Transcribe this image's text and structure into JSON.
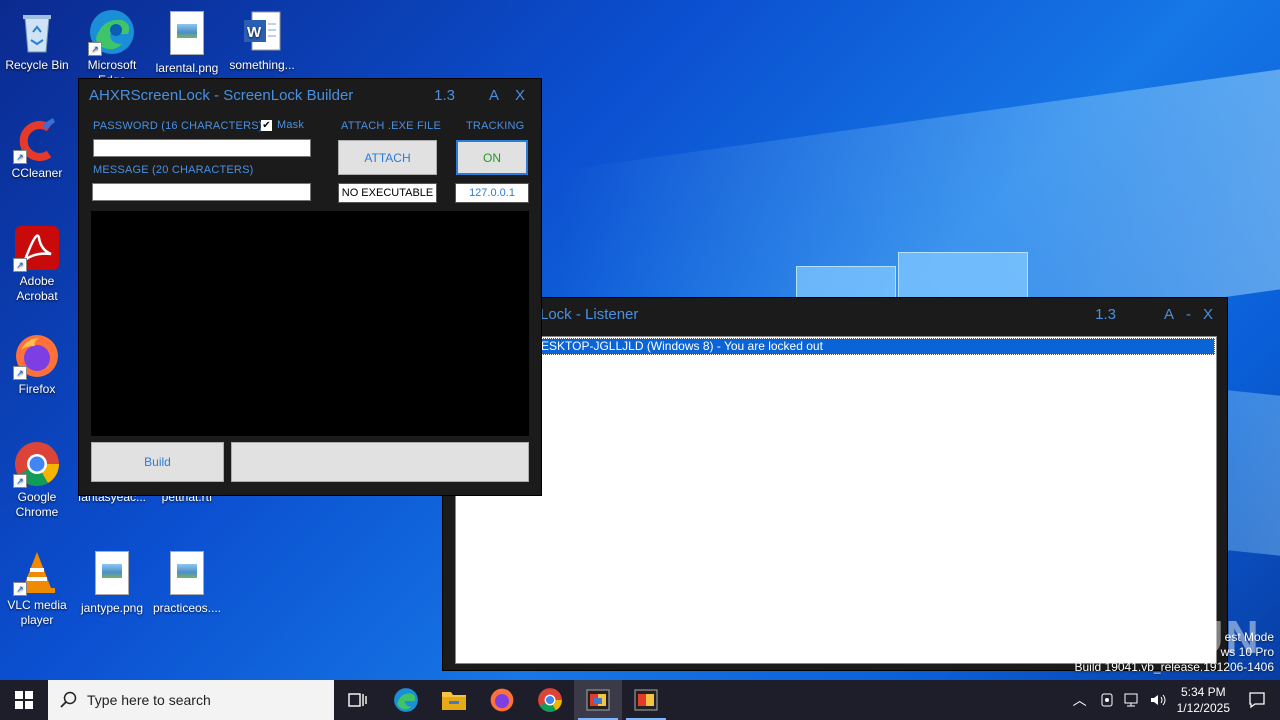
{
  "desktop": {
    "icons": [
      {
        "label": "Recycle Bin",
        "icon": "recycle-bin-icon"
      },
      {
        "label": "Microsoft Edge",
        "icon": "edge-icon"
      },
      {
        "label": "larental.png",
        "icon": "image-file-icon"
      },
      {
        "label": "something...",
        "icon": "word-document-icon"
      },
      {
        "label": "CCleaner",
        "icon": "ccleaner-icon"
      },
      {
        "label": "Adobe Acrobat",
        "icon": "acrobat-icon"
      },
      {
        "label": "Firefox",
        "icon": "firefox-icon"
      },
      {
        "label": "Google Chrome",
        "icon": "chrome-icon"
      },
      {
        "label": "VLC media player",
        "icon": "vlc-icon"
      },
      {
        "label": "jantype.png",
        "icon": "image-file-icon"
      },
      {
        "label": "practiceos....",
        "icon": "image-file-icon"
      },
      {
        "label": "fantasyeac...",
        "icon": "file-icon"
      },
      {
        "label": "pettnat.rtf",
        "icon": "file-icon"
      }
    ],
    "watermark_lines": [
      "est Mode",
      "ws 10 Pro",
      "Build 19041.vb_release.191206-1406"
    ],
    "watermark_brand": "ANY RUN"
  },
  "builder": {
    "title": "AHXRScreenLock - ScreenLock Builder",
    "version": "1.3",
    "btn_a": "A",
    "btn_close": "X",
    "password_label": "PASSWORD (16 CHARACTERS)",
    "password_value": "",
    "mask_label": "Mask",
    "mask_checked": true,
    "message_label": "MESSAGE (20 CHARACTERS)",
    "message_value": "",
    "attach_label": "ATTACH .EXE FILE",
    "attach_button": "ATTACH",
    "attach_status": "NO EXECUTABLE",
    "tracking_label": "TRACKING",
    "tracking_button": "ON",
    "tracking_ip": "127.0.0.1",
    "build_button": "Build",
    "status_value": ""
  },
  "listener": {
    "title": "Lock - Listener",
    "version": "1.3",
    "btn_a": "A",
    "btn_min": "-",
    "btn_close": "X",
    "entries": [
      "ESKTOP-JGLLJLD (Windows 8) - You are locked out"
    ]
  },
  "taskbar": {
    "search_placeholder": "Type here to search",
    "time": "5:34 PM",
    "date": "1/12/2025",
    "apps": [
      "task-view-icon",
      "edge-icon",
      "file-explorer-icon",
      "firefox-icon",
      "chrome-icon",
      "screenlock-builder-icon",
      "screenlock-listener-icon"
    ]
  },
  "colors": {
    "accent": "#4a90e2",
    "window_bg": "#1b1b1b",
    "selection": "#0a64d6",
    "tracking_text": "#1f9d1f"
  }
}
